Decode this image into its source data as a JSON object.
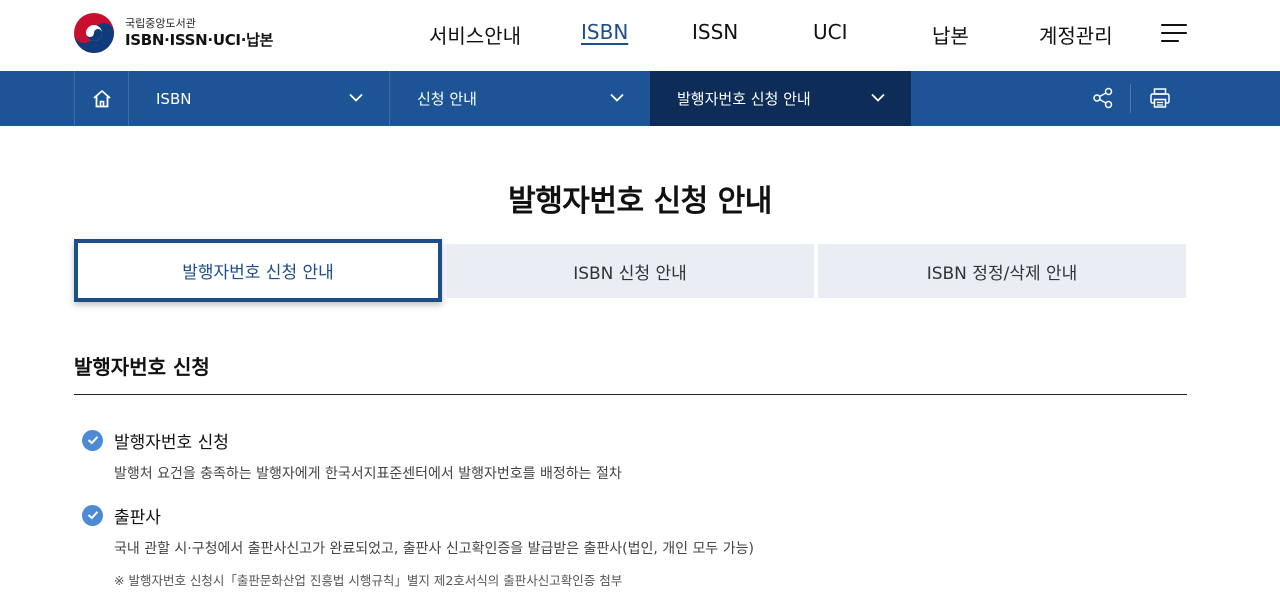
{
  "logo": {
    "sub": "국립중앙도서관",
    "main": "ISBN·ISSN·UCI·납본"
  },
  "gnb": {
    "items": [
      {
        "label": "서비스안내"
      },
      {
        "label": "ISBN"
      },
      {
        "label": "ISSN"
      },
      {
        "label": "UCI"
      },
      {
        "label": "납본"
      },
      {
        "label": "계정관리"
      }
    ],
    "active_index": 1
  },
  "location": {
    "level1": "ISBN",
    "level2": "신청 안내",
    "level3": "발행자번호 신청 안내"
  },
  "page": {
    "title": "발행자번호 신청 안내"
  },
  "tabs": [
    {
      "label": "발행자번호 신청 안내",
      "active": true
    },
    {
      "label": "ISBN 신청 안내",
      "active": false
    },
    {
      "label": "ISBN 정정/삭제 안내",
      "active": false
    }
  ],
  "section": {
    "title": "발행자번호 신청",
    "items": [
      {
        "title": "발행자번호 신청",
        "desc": "발행처 요건을 충족하는 발행자에게 한국서지표준센터에서 발행자번호를 배정하는 절차"
      },
      {
        "title": "출판사",
        "desc": "국내 관할 시·구청에서 출판사신고가 완료되었고, 출판사 신고확인증을 발급받은 출판사(법인, 개인 모두 가능)",
        "note": "※ 발행자번호 신청시「출판문화산업 진흥법 시행규칙」별지 제2호서식의 출판사신고확인증 첨부"
      }
    ]
  },
  "colors": {
    "brand": "#1d5495",
    "brand_dark": "#0d2c57",
    "active_text": "#1d4e89",
    "check": "#4d8ad6",
    "tab_bg": "#e9edf4"
  }
}
